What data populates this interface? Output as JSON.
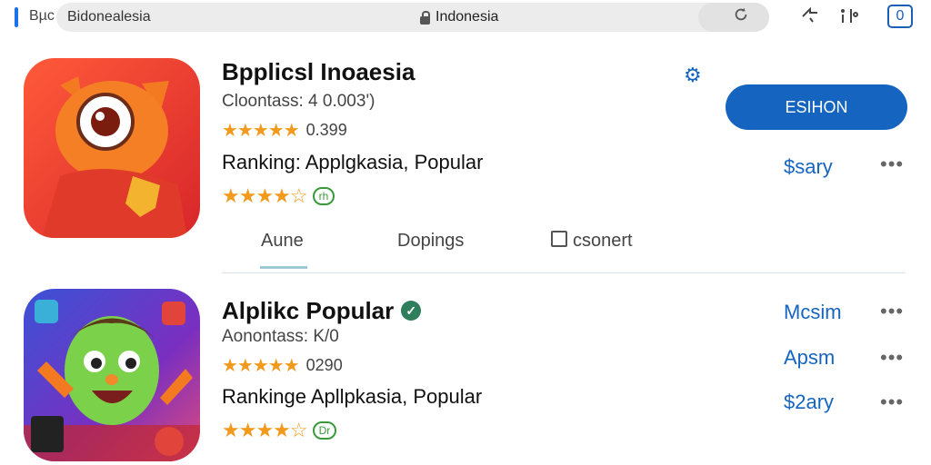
{
  "browser": {
    "left_text": "Bµc",
    "url_text": "Bidonealesia",
    "center_text": "Indonesia"
  },
  "apps": [
    {
      "title": "Bpplicsl Inoaesia",
      "subtitle": "Cloontass: 4 0.003')",
      "rating_count": "0.399",
      "ranking": "Ranking: Applgkasia, Popular",
      "badge": "rh",
      "action_label": "ESIHON",
      "side_link": "$sary"
    },
    {
      "title": "Alplikc Popular",
      "subtitle": "Aonontass: K/0",
      "rating_count": "0290",
      "ranking": "Rankinge Apllpkasia, Popular",
      "badge": "Dr",
      "side_links": [
        "Mcsim",
        "Apsm",
        "$2ary"
      ]
    }
  ],
  "tabs": [
    "Aune",
    "Dopings",
    "csonert"
  ],
  "colors": {
    "accent": "#1565c0",
    "star": "#f19a1e",
    "verified": "#2e7d5b"
  }
}
